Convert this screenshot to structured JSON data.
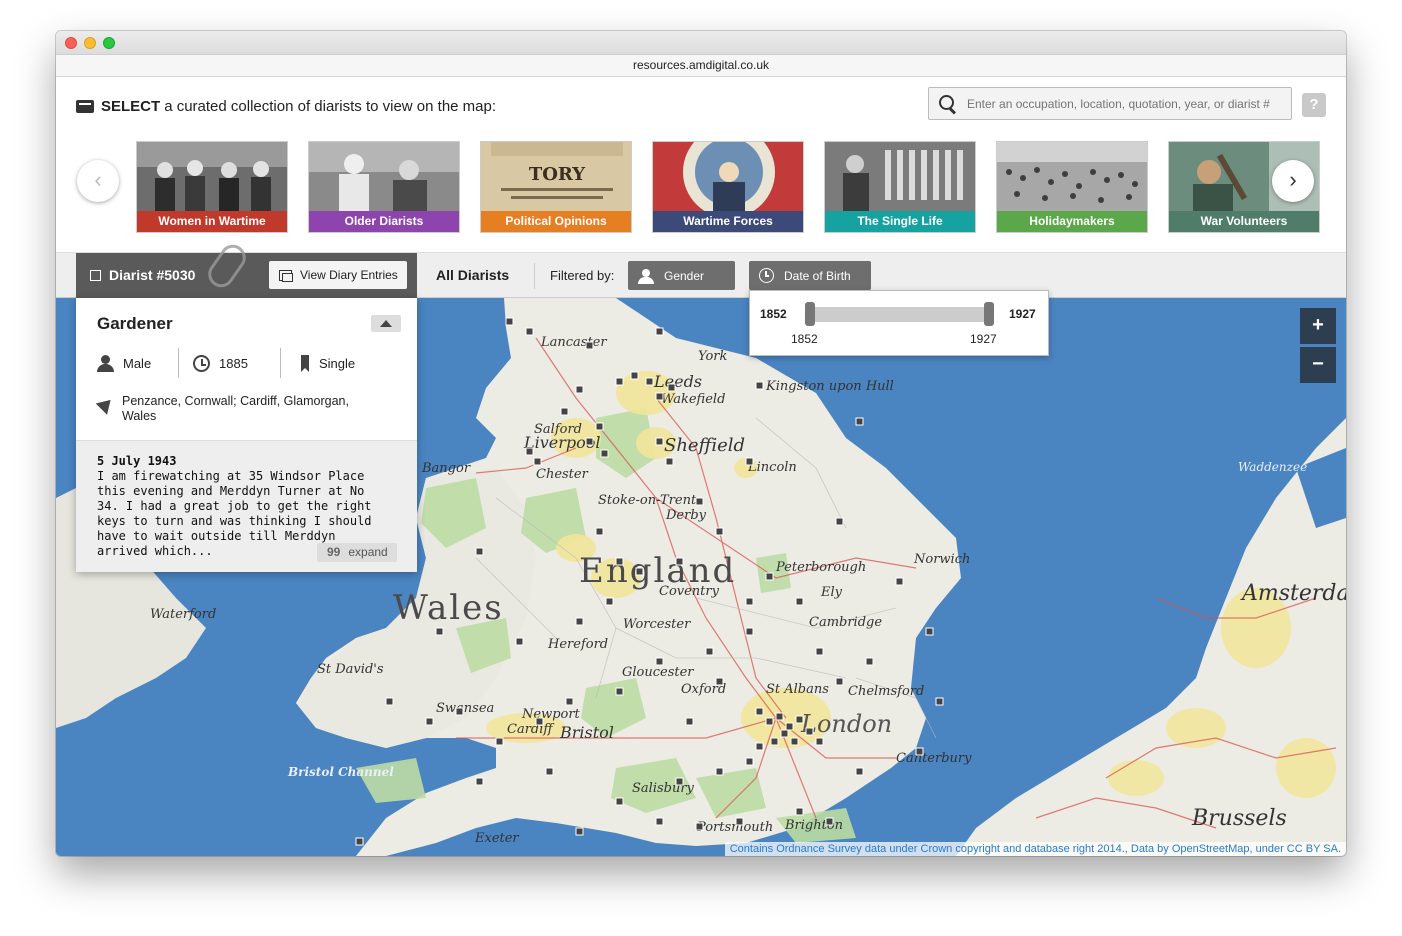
{
  "browser": {
    "url": "resources.amdigital.co.uk"
  },
  "header": {
    "select_bold": "SELECT",
    "select_rest": "a curated collection of diarists to view on the map:",
    "search_placeholder": "Enter an occupation, location, quotation, year, or diarist #",
    "help_label": "?"
  },
  "collections": [
    {
      "label": "Women in Wartime",
      "color": "#c0392b"
    },
    {
      "label": "Older Diarists",
      "color": "#8e44ad"
    },
    {
      "label": "Political Opinions",
      "color": "#e67e22"
    },
    {
      "label": "Wartime Forces",
      "color": "#3b4a78"
    },
    {
      "label": "The Single Life",
      "color": "#17a2a2"
    },
    {
      "label": "Holidaymakers",
      "color": "#5aa84a"
    },
    {
      "label": "War Volunteers",
      "color": "#4f7d6a"
    }
  ],
  "carousel": {
    "prev_icon": "chevron-left-icon",
    "next_icon": "chevron-right-icon",
    "prev": "‹",
    "next": "›"
  },
  "toolbar": {
    "diarist_title": "Diarist #5030",
    "view_entries_label": "View Diary Entries",
    "all_diarists": "All Diarists",
    "filtered_by": "Filtered by:",
    "gender_label": "Gender",
    "dob_label": "Date of Birth"
  },
  "date_filter": {
    "min": "1852",
    "max": "1927",
    "selected_min": "1852",
    "selected_max": "1927"
  },
  "diarist_card": {
    "occupation": "Gardener",
    "gender": "Male",
    "birth_year": "1885",
    "marital_status": "Single",
    "location": "Penzance, Cornwall; Cardiff, Glamorgan, Wales",
    "entry_date": "5 July 1943",
    "entry_text": "I am firewatching at 35 Windsor Place\nthis evening and Merddyn Turner at No\n34. I had a great job to get the right\nkeys to turn and was thinking I should\nhave to wait outside till Merddyn\narrived which...",
    "expand_label": "expand",
    "expand_quote": "99"
  },
  "map": {
    "zoom_in": "+",
    "zoom_out": "−",
    "attribution": "Contains Ordnance Survey data under Crown copyright and database right 2014., Data by OpenStreetMap, under CC BY SA.",
    "labels": {
      "england": "England",
      "wales": "Wales",
      "lancaster": "Lancaster",
      "york": "York",
      "leeds": "Leeds",
      "wakefield": "Wakefield",
      "hull": "Kingston upon Hull",
      "salford": "Salford",
      "liverpool": "Liverpool",
      "sheffield": "Sheffield",
      "lincoln": "Lincoln",
      "bangor": "Bangor",
      "chester": "Chester",
      "stoke": "Stoke-on-Trent",
      "derby": "Derby",
      "norwich": "Norwich",
      "peterborough": "Peterborough",
      "coventry": "Coventry",
      "ely": "Ely",
      "cambridge": "Cambridge",
      "waterford": "Waterford",
      "worcester": "Worcester",
      "hereford": "Hereford",
      "st_davids": "St David's",
      "gloucester": "Gloucester",
      "oxford": "Oxford",
      "st_albans": "St Albans",
      "chelmsford": "Chelmsford",
      "swansea": "Swansea",
      "newport": "Newport",
      "cardiff": "Cardiff",
      "bristol": "Bristol",
      "london": "London",
      "bristol_channel": "Bristol Channel",
      "canterbury": "Canterbury",
      "salisbury": "Salisbury",
      "exeter": "Exeter",
      "portsmouth": "Portsmouth",
      "brighton": "Brighton",
      "brussels": "Brussels",
      "amsterdam": "Amsterdam",
      "waddenzee": "Waddenzee"
    }
  }
}
